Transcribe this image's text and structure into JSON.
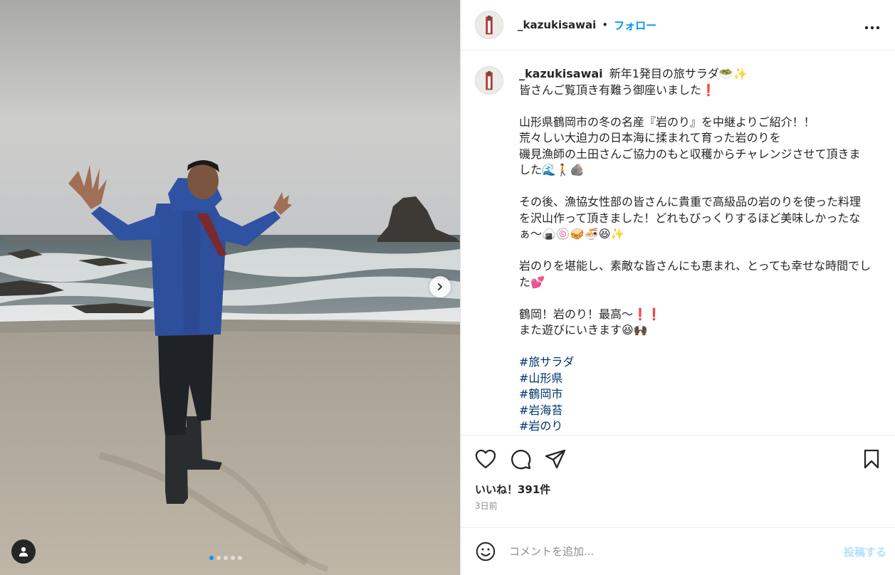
{
  "post": {
    "username": "_kazukisawai",
    "separator": "•",
    "follow_label": "フォロー",
    "more_label": "•••",
    "carousel": {
      "total_images": 5,
      "active_index": 0
    }
  },
  "caption": {
    "username": "_kazukisawai",
    "blocks": [
      [
        "新年1発目の旅サラダ🥗✨",
        "皆さんご覧頂き有難う御座いました❗"
      ],
      [
        "山形県鶴岡市の冬の名産『岩のり』を中継よりご紹介！！",
        "荒々しい大迫力の日本海に揉まれて育った岩のりを",
        "磯見漁師の土田さんご協力のもと収穫からチャレンジさせて頂きました🌊🚶🪨"
      ],
      [
        "その後、漁協女性部の皆さんに貴重で高級品の岩のりを使った料理を沢山作って頂きました！どれもびっくりするほど美味しかったなぁ〜🍙🍥🥪🍜😆✨"
      ],
      [
        "岩のりを堪能し、素敵な皆さんにも恵まれ、とっても幸せな時間でした💕"
      ],
      [
        "鶴岡！岩のり！最高〜❗❗",
        "また遊びにいきます😆🙌🏿"
      ]
    ],
    "hashtags": [
      "#旅サラダ",
      "#山形県",
      "#鶴岡市",
      "#岩海苔",
      "#岩のり"
    ]
  },
  "likes_label": "いいね！391件",
  "time_label": "3日前",
  "comment": {
    "placeholder": "コメントを追加...",
    "post_label": "投稿する"
  },
  "colors": {
    "accent": "#0095f6",
    "hashtag": "#00376b",
    "post_disabled": "#b2dffc",
    "muted": "#8e8e8e"
  },
  "icons": [
    "heart-icon",
    "comment-icon",
    "share-icon",
    "bookmark-icon",
    "emoji-icon",
    "user-tag-icon",
    "chevron-right-icon"
  ]
}
